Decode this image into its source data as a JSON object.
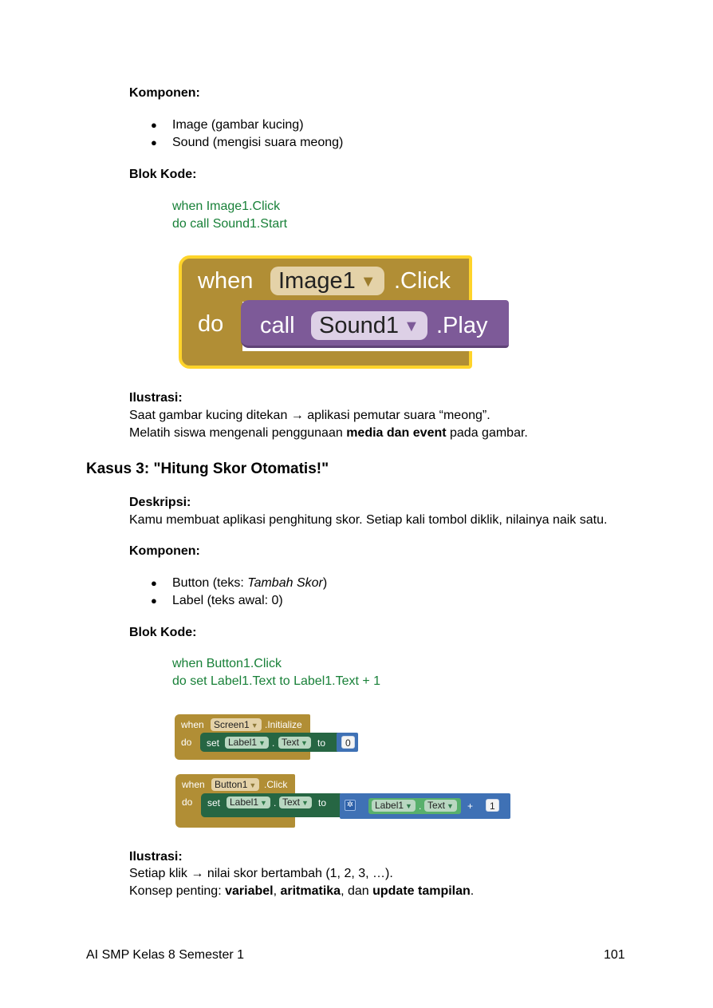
{
  "section1": {
    "components_label": "Komponen:",
    "components": [
      "Image (gambar kucing)",
      "Sound (mengisi suara meong)"
    ],
    "code_label": "Blok Kode:",
    "code_lines": [
      "when Image1.Click",
      "do call Sound1.Start"
    ],
    "block": {
      "when": "when",
      "component": "Image1",
      "event": ".Click",
      "do": "do",
      "call": "call",
      "call_component": "Sound1",
      "method": ".Play"
    },
    "illustration_label": "Ilustrasi:",
    "illustration_line1": "Saat gambar kucing ditekan → aplikasi pemutar suara “meong”.",
    "illustration_line2_pre": "Melatih siswa mengenali penggunaan ",
    "illustration_line2_bold": "media dan event",
    "illustration_line2_post": " pada gambar."
  },
  "section2": {
    "heading": "Kasus 3: \"Hitung Skor Otomatis!\"",
    "description_label": "Deskripsi:",
    "description": "Kamu membuat aplikasi penghitung skor. Setiap kali tombol diklik, nilainya naik satu.",
    "components_label": "Komponen:",
    "components": [
      {
        "pre": "Button (teks: ",
        "italic": "Tambah Skor",
        "post": ")"
      },
      {
        "pre": "Label (teks awal: 0)",
        "italic": "",
        "post": ""
      }
    ],
    "code_label": "Blok Kode:",
    "code_lines": [
      "when Button1.Click",
      "do set Label1.Text to Label1.Text + 1"
    ],
    "block1": {
      "when": "when",
      "component": "Screen1",
      "event": ".Initialize",
      "do": "do",
      "set": "set",
      "target": "Label1",
      "dot": ".",
      "prop": "Text",
      "to": "to",
      "value": "0"
    },
    "block2": {
      "when": "when",
      "component": "Button1",
      "event": ".Click",
      "do": "do",
      "set": "set",
      "target": "Label1",
      "dot": ".",
      "prop": "Text",
      "to": "to",
      "get_component": "Label1",
      "get_dot": ".",
      "get_prop": "Text",
      "plus": "+",
      "value": "1"
    },
    "illustration_label": "Ilustrasi:",
    "illustration_line1": "Setiap klik → nilai skor bertambah (1, 2, 3, …).",
    "concept_pre": "Konsep penting: ",
    "concept_b1": "variabel",
    "concept_sep1": ", ",
    "concept_b2": "aritmatika",
    "concept_sep2": ", dan ",
    "concept_b3": "update tampilan",
    "concept_end": "."
  },
  "footer": {
    "left": "AI SMP Kelas 8 Semester 1",
    "page_number": "101"
  },
  "colors": {
    "code_text": "#188038",
    "event_block": "#b18e35",
    "event_highlight": "#ffd42a",
    "call_block": "#7d5a98",
    "set_block": "#266643",
    "math_block": "#3f71b5"
  }
}
